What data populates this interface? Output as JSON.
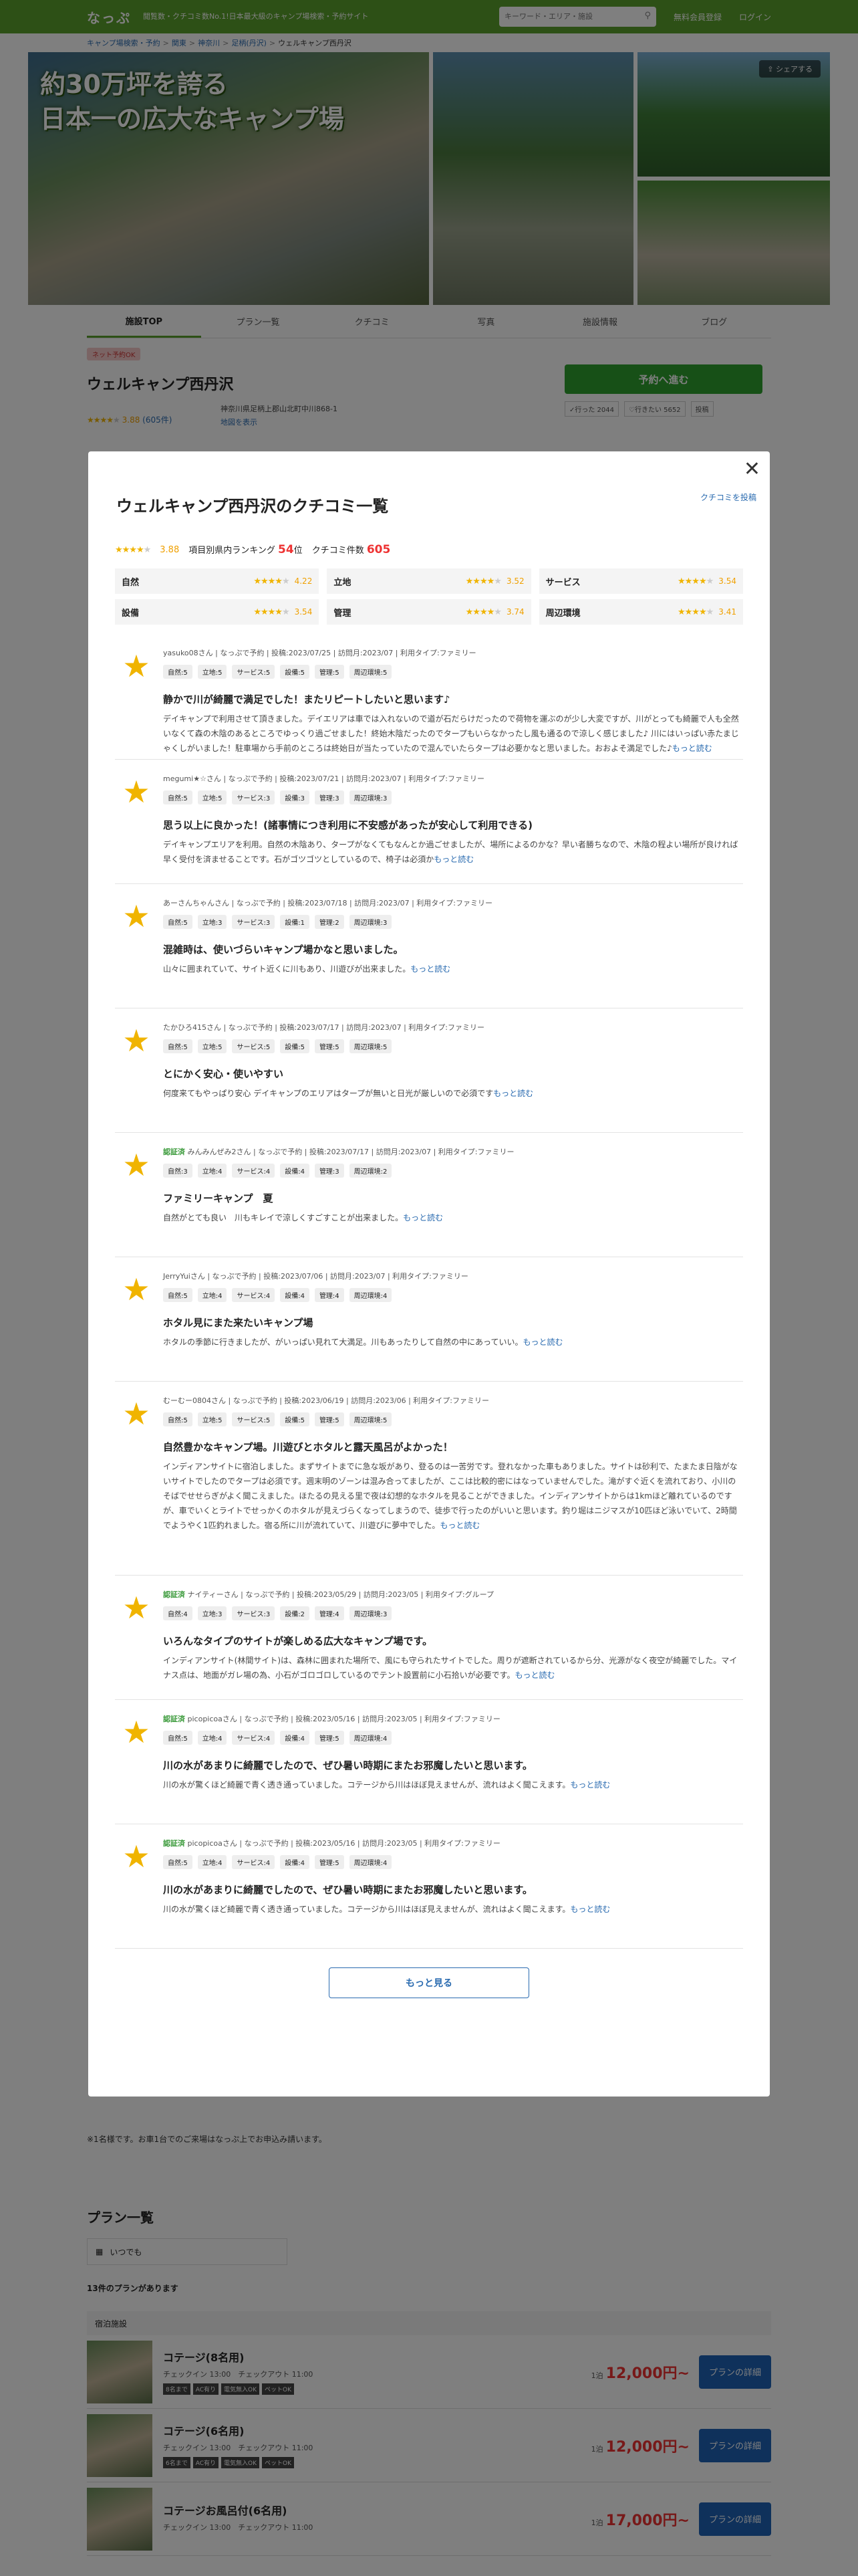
{
  "header": {
    "logo": "なっぷ",
    "tagline_1": "閲覧数・クチコミ数No.1!日本最大級のキャンプ場検索・予約サイト",
    "search_placeholder": "キーワード・エリア・施設",
    "register": "無料会員登録",
    "login": "ログイン"
  },
  "breadcrumb": [
    "キャンプ場検索・予約",
    "関東",
    "神奈川",
    "足柄(丹沢)",
    "ウェルキャンプ西丹沢"
  ],
  "hero": {
    "copy_1": "約30万坪を誇る",
    "copy_2": "日本一の広大なキャンプ場",
    "share": "シェアする"
  },
  "tabs": [
    "施設TOP",
    "プラン一覧",
    "クチコミ",
    "写真",
    "施設情報",
    "ブログ"
  ],
  "campsite": {
    "badge": "ネット予約OK",
    "name": "ウェルキャンプ西丹沢",
    "address": "神奈川県足柄上郡山北町中川868-1",
    "map_link": "地図を表示",
    "rating": "3.88",
    "reviews": "(605件)",
    "went": "✓行った 2044",
    "want": "♡行きたい 5652",
    "other": "投稿",
    "reserve": "予約へ進む"
  },
  "modal": {
    "title": "ウェルキャンプ西丹沢のクチコミ一覧",
    "post_link": "クチコミを投稿",
    "overall_rating": "3.88",
    "ranking_label": "項目別県内ランキング",
    "ranking_value": "54",
    "ranking_unit": "位",
    "count_label": "クチコミ件数",
    "count_value": "605",
    "categories": [
      {
        "label": "自然",
        "score": "4.22",
        "stars": 4
      },
      {
        "label": "立地",
        "score": "3.52",
        "stars": 3.5
      },
      {
        "label": "サービス",
        "score": "3.54",
        "stars": 3.5
      },
      {
        "label": "設備",
        "score": "3.54",
        "stars": 3.5
      },
      {
        "label": "管理",
        "score": "3.74",
        "stars": 3.5
      },
      {
        "label": "周辺環境",
        "score": "3.41",
        "stars": 3.5
      }
    ],
    "more_button": "もっと見る",
    "reviews": [
      {
        "new": "",
        "meta": "yasuko08さん | なっぷで予約 | 投稿:2023/07/25 | 訪問月:2023/07 | 利用タイプ:ファミリー",
        "chips": [
          "自然:5",
          "立地:5",
          "サービス:5",
          "設備:5",
          "管理:5",
          "周辺環境:5"
        ],
        "title": "静かで川が綺麗で満足でした！またリピートしたいと思います♪",
        "body": "デイキャンプで利用させて頂きました。デイエリアは車では入れないので道が石だらけだったので荷物を運ぶのが少し大変ですが、川がとっても綺麗で人も全然いなくて森の木陰のあるところでゆっくり過ごせました！終始木陰だったのでタープもいらなかったし風も通るので涼しく感じました♪ 川にはいっぱい赤たまじゃくしがいました！駐車場から手前のところは終始日が当たっていたので混んでいたらタープは必要かなと思いました。おおよそ満足でした♪",
        "more": "もっと読む"
      },
      {
        "new": "",
        "meta": "megumi★☆さん | なっぷで予約 | 投稿:2023/07/21 | 訪問月:2023/07 | 利用タイプ:ファミリー",
        "chips": [
          "自然:5",
          "立地:5",
          "サービス:3",
          "設備:3",
          "管理:3",
          "周辺環境:3"
        ],
        "title": "思う以上に良かった！(諸事情につき利用に不安感があったが安心して利用できる)",
        "body": "デイキャンプエリアを利用。自然の木陰あり、タープがなくてもなんとか過ごせましたが、場所によるのかな？早い者勝ちなので、木陰の程よい場所が良ければ早く受付を済ませることです。石がゴツゴツとしているので、椅子は必須か",
        "more": "もっと読む"
      },
      {
        "new": "",
        "meta": "あーさんちゃんさん | なっぷで予約 | 投稿:2023/07/18 | 訪問月:2023/07 | 利用タイプ:ファミリー",
        "chips": [
          "自然:5",
          "立地:3",
          "サービス:3",
          "設備:1",
          "管理:2",
          "周辺環境:3"
        ],
        "title": "混雑時は、使いづらいキャンプ場かなと思いました。",
        "body": "山々に囲まれていて、サイト近くに川もあり、川遊びが出来ました。",
        "more": "もっと読む"
      },
      {
        "new": "",
        "meta": "たかひろ415さん | なっぷで予約 | 投稿:2023/07/17 | 訪問月:2023/07 | 利用タイプ:ファミリー",
        "chips": [
          "自然:5",
          "立地:5",
          "サービス:5",
          "設備:5",
          "管理:5",
          "周辺環境:5"
        ],
        "title": "とにかく安心・使いやすい",
        "body": "何度来てもやっぱり安心 デイキャンプのエリアはタープが無いと日光が厳しいので必須です",
        "more": "もっと読む"
      },
      {
        "new": "認証済",
        "meta": "みんみんぜみ2さん | なっぷで予約 | 投稿:2023/07/17 | 訪問月:2023/07 | 利用タイプ:ファミリー",
        "chips": [
          "自然:3",
          "立地:4",
          "サービス:4",
          "設備:4",
          "管理:3",
          "周辺環境:2"
        ],
        "title": "ファミリーキャンプ　夏",
        "body": "自然がとても良い　川もキレイで涼しくすごすことが出来ました。",
        "more": "もっと読む"
      },
      {
        "new": "",
        "meta": "JerryYuiさん | なっぷで予約 | 投稿:2023/07/06 | 訪問月:2023/07 | 利用タイプ:ファミリー",
        "chips": [
          "自然:5",
          "立地:4",
          "サービス:4",
          "設備:4",
          "管理:4",
          "周辺環境:4"
        ],
        "title": "ホタル見にまた来たいキャンプ場",
        "body": "ホタルの季節に行きましたが、がいっぱい見れて大満足。川もあったりして自然の中にあっていい。",
        "more": "もっと読む"
      },
      {
        "new": "",
        "meta": "むーむー0804さん | なっぷで予約 | 投稿:2023/06/19 | 訪問月:2023/06 | 利用タイプ:ファミリー",
        "chips": [
          "自然:5",
          "立地:5",
          "サービス:5",
          "設備:5",
          "管理:5",
          "周辺環境:5"
        ],
        "title": "自然豊かなキャンプ場。川遊びとホタルと露天風呂がよかった！",
        "body": "インディアンサイトに宿泊しました。まずサイトまでに急な坂があり、登るのは一苦労です。登れなかった車もありました。サイトは砂利で、たまたま日陰がないサイトでしたのでタープは必須です。週末明のゾーンは混み合ってましたが、ここは比較的密にはなっていませんでした。滝がすぐ近くを流れており、小川のそばでせせらぎがよく聞こえました。ほたるの見える里で夜は幻想的なホタルを見ることができました。インディアンサイトからは1kmほど離れているのですが、車でいくとライトでせっかくのホタルが見えづらくなってしまうので、徒歩で行ったのがいいと思います。釣り堀はニジマスが10匹ほど泳いでいて、2時間でようやく1匹釣れました。宿る所に川が流れていて、川遊びに夢中でした。",
        "more": "もっと読む"
      },
      {
        "new": "認証済",
        "meta": "ナイティーさん | なっぷで予約 | 投稿:2023/05/29 | 訪問月:2023/05 | 利用タイプ:グループ",
        "chips": [
          "自然:4",
          "立地:3",
          "サービス:3",
          "設備:2",
          "管理:4",
          "周辺環境:3"
        ],
        "title": "いろんなタイプのサイトが楽しめる広大なキャンプ場です。",
        "body": "インディアンサイト(林間サイト)は、森林に囲まれた場所で、風にも守られたサイトでした。周りが遮断されているから分、光源がなく夜空が綺麗でした。マイナス点は、地面がガレ場の為、小石がゴロゴロしているのでテント設置前に小石拾いが必要です。",
        "more": "もっと読む"
      },
      {
        "new": "認証済",
        "meta": "picopicoaさん | なっぷで予約 | 投稿:2023/05/16 | 訪問月:2023/05 | 利用タイプ:ファミリー",
        "chips": [
          "自然:5",
          "立地:4",
          "サービス:4",
          "設備:4",
          "管理:5",
          "周辺環境:4"
        ],
        "title": "川の水があまりに綺麗でしたので、ぜひ暑い時期にまたお邪魔したいと思います。",
        "body": "川の水が驚くほど綺麗で青く透き通っていました。コテージから川はほぼ見えませんが、流れはよく聞こえます。",
        "more": "もっと読む"
      },
      {
        "new": "認証済",
        "meta": "picopicoaさん | なっぷで予約 | 投稿:2023/05/16 | 訪問月:2023/05 | 利用タイプ:ファミリー",
        "chips": [
          "自然:5",
          "立地:4",
          "サービス:4",
          "設備:4",
          "管理:5",
          "周辺環境:4"
        ],
        "title": "川の水があまりに綺麗でしたので、ぜひ暑い時期にまたお邪魔したいと思います。",
        "body": "川の水が驚くほど綺麗で青く透き通っていました。コテージから川はほぼ見えませんが、流れはよく聞こえます。",
        "more": "もっと読む"
      }
    ]
  },
  "notice": "※1名様です。お車1台でのご来場はなっぷ上でお申込み請います。",
  "plans": {
    "title": "プラン一覧",
    "date_select": "いつでも",
    "count": "13件のプランがあります",
    "section": "宿泊施設",
    "items": [
      {
        "name": "コテージ(8名用)",
        "time": "チェックイン 13:00　チェックアウト 11:00",
        "tags": [
          "8名まで",
          "AC有り",
          "電気無入OK",
          "ペットOK"
        ],
        "price_prefix": "1泊",
        "price": "12,000円~",
        "button": "プランの詳細"
      },
      {
        "name": "コテージ(6名用)",
        "time": "チェックイン 13:00　チェックアウト 11:00",
        "tags": [
          "6名まで",
          "AC有り",
          "電気無入OK",
          "ペットOK"
        ],
        "price_prefix": "1泊",
        "price": "12,000円~",
        "button": "プランの詳細"
      },
      {
        "name": "コテージお風呂付(6名用)",
        "time": "チェックイン 13:00　チェックアウト 11:00",
        "tags": [],
        "price_prefix": "1泊",
        "price": "17,000円~",
        "button": "プランの詳細"
      }
    ]
  }
}
